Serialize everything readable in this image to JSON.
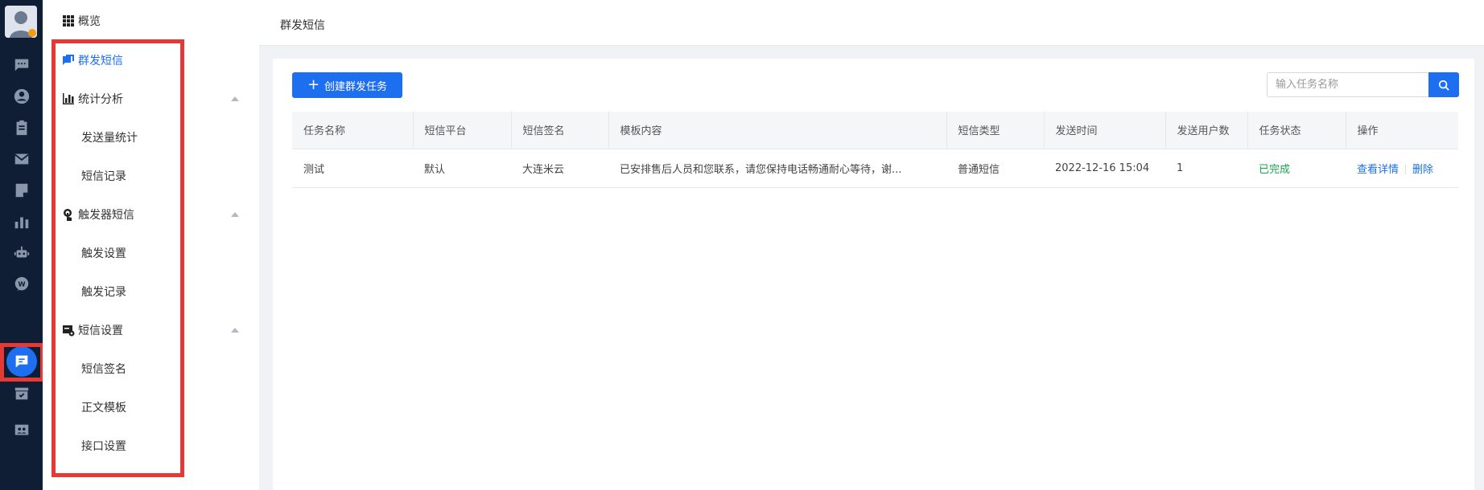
{
  "page_title": "群发短信",
  "sidebar": {
    "rail_items": [
      "chat-icon",
      "user-icon",
      "clipboard-icon",
      "mail-icon",
      "document-icon",
      "bar-chart-icon",
      "robot-icon",
      "wechat-icon",
      "sms-icon",
      "storefront-icon",
      "contacts-icon"
    ],
    "menu": [
      {
        "label": "概览",
        "icon": "grid-icon"
      },
      {
        "label": "群发短信",
        "icon": "sms-copy-icon",
        "active": true
      },
      {
        "label": "统计分析",
        "icon": "stats-icon",
        "expanded": true
      },
      {
        "label": "发送量统计",
        "sub": true
      },
      {
        "label": "短信记录",
        "sub": true
      },
      {
        "label": "触发器短信",
        "icon": "touch-icon",
        "expanded": true
      },
      {
        "label": "触发设置",
        "sub": true
      },
      {
        "label": "触发记录",
        "sub": true
      },
      {
        "label": "短信设置",
        "icon": "settings-card-icon",
        "expanded": true
      },
      {
        "label": "短信签名",
        "sub": true
      },
      {
        "label": "正文模板",
        "sub": true
      },
      {
        "label": "接口设置",
        "sub": true
      }
    ]
  },
  "toolbar": {
    "create_label": "创建群发任务",
    "search_placeholder": "输入任务名称"
  },
  "table": {
    "columns": [
      "任务名称",
      "短信平台",
      "短信签名",
      "模板内容",
      "短信类型",
      "发送时间",
      "发送用户数",
      "任务状态",
      "操作"
    ],
    "rows": [
      {
        "name": "测试",
        "platform": "默认",
        "signature": "大连米云",
        "template": "已安排售后人员和您联系，请您保持电话畅通耐心等待，谢...",
        "type": "普通短信",
        "time": "2022-12-16 15:04",
        "users": "1",
        "status": "已完成",
        "action_view": "查看详情",
        "action_delete": "删除"
      }
    ]
  },
  "colors": {
    "accent": "#1e6ff0",
    "rail_bg": "#0f1d35",
    "status_done": "#19a54a",
    "highlight": "#e53935"
  }
}
